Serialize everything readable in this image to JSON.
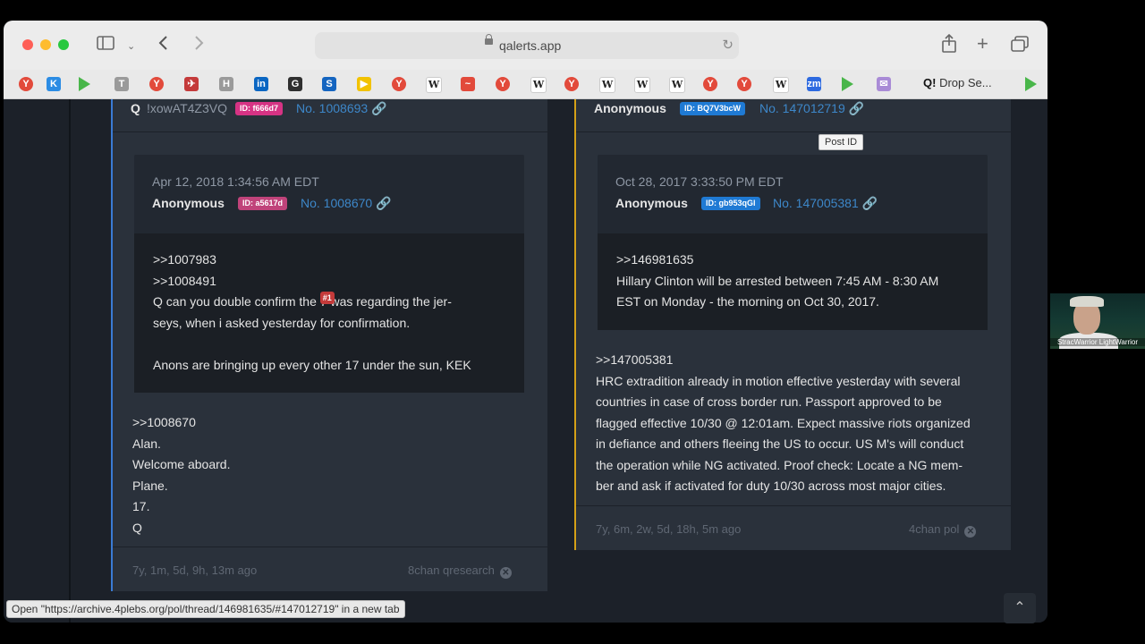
{
  "browser": {
    "url": "qalerts.app",
    "tab_title": "Drop Se...",
    "tab_q": "Q!",
    "status_link": "Open \"https://archive.4plebs.org/pol/thread/146981635/#147012719\" in a new tab",
    "tooltip": "Post ID"
  },
  "icons": {
    "back": "chevron-left-icon",
    "forward": "chevron-right-icon",
    "share": "share-icon",
    "newtab": "plus-icon",
    "tabs": "tab-overview-icon",
    "sidebar": "sidebar-icon",
    "reload": "reload-icon",
    "lock": "lock-icon"
  },
  "favorites": [
    {
      "glyph": "Y",
      "color": "#e24a3b"
    },
    {
      "glyph": "K",
      "color": "#2b8ce4"
    },
    {
      "glyph": "",
      "color": "#49b64a"
    },
    {
      "glyph": "T",
      "color": "#9a9a9a"
    },
    {
      "glyph": "Y",
      "color": "#e24a3b"
    },
    {
      "glyph": "✈",
      "color": "#c43a3a"
    },
    {
      "glyph": "H",
      "color": "#9a9a9a"
    },
    {
      "glyph": "in",
      "color": "#0a66c2"
    },
    {
      "glyph": "G",
      "color": "#2f2f2f"
    },
    {
      "glyph": "S",
      "color": "#1565c0"
    },
    {
      "glyph": "▶",
      "color": "#f2c200"
    },
    {
      "glyph": "Y",
      "color": "#e24a3b"
    },
    {
      "glyph": "W",
      "color": "#ffffff"
    },
    {
      "glyph": "~",
      "color": "#e24a3b"
    },
    {
      "glyph": "Y",
      "color": "#e24a3b"
    },
    {
      "glyph": "W",
      "color": "#ffffff"
    },
    {
      "glyph": "Y",
      "color": "#e24a3b"
    },
    {
      "glyph": "W",
      "color": "#ffffff"
    },
    {
      "glyph": "W",
      "color": "#ffffff"
    },
    {
      "glyph": "W",
      "color": "#ffffff"
    },
    {
      "glyph": "Y",
      "color": "#e24a3b"
    },
    {
      "glyph": "Y",
      "color": "#e24a3b"
    },
    {
      "glyph": "W",
      "color": "#ffffff"
    },
    {
      "glyph": "zm",
      "color": "#2d6ae0"
    },
    {
      "glyph": "",
      "color": "#49b64a"
    },
    {
      "glyph": "✉",
      "color": "#a98bd6"
    }
  ],
  "left_post": {
    "author": "Q",
    "tripcode": "!xowAT4Z3VQ",
    "id_badge": "ID: f666d7",
    "id_color": "#d63384",
    "post_no": "No. 1008693",
    "quoted": {
      "date": "Apr 12, 2018 1:34:56 AM EDT",
      "author": "Anonymous",
      "id_badge": "ID: a5617d",
      "id_color": "#c0437a",
      "post_no": "No. 1008670",
      "line1": ">>1007983",
      "line2": ">>1008491",
      "line3_pre": "Q can you double confirm the ",
      "line3_badge": "#1",
      "line3_post": "7 was regarding the jer-",
      "line4": "seys, when i asked yesterday for confirmation.",
      "line5": "Anons are bringing up every other 17 under the sun, KEK"
    },
    "body": [
      ">>1008670",
      "Alan.",
      "Welcome aboard.",
      "Plane.",
      "17.",
      "Q"
    ],
    "age": "7y, 1m, 5d, 9h, 13m ago",
    "source": "8chan qresearch"
  },
  "right_post": {
    "author": "Anonymous",
    "id_badge": "ID: BQ7V3bcW",
    "id_color": "#1f7ad4",
    "post_no": "No. 147012719",
    "quoted": {
      "date": "Oct 28, 2017 3:33:50 PM EDT",
      "author": "Anonymous",
      "id_badge": "ID: gb953qGl",
      "id_color": "#1f7ad4",
      "post_no": "No. 147005381",
      "line1": ">>146981635",
      "line2": "Hillary Clinton will be arrested between 7:45 AM - 8:30 AM",
      "line3": "EST on Monday - the morning on Oct 30, 2017."
    },
    "body": [
      ">>147005381",
      "HRC extradition already in motion effective yesterday with several",
      "countries in case of cross border run. Passport approved to be",
      "flagged effective 10/30 @ 12:01am. Expect massive riots organized",
      "in defiance and others fleeing the US to occur. US M's will conduct",
      "the operation while NG activated. Proof check: Locate a NG mem-",
      "ber and ask if activated for duty 10/30 across most major cities."
    ],
    "age": "7y, 6m, 2w, 5d, 18h, 5m ago",
    "source": "4chan pol"
  },
  "webcam_caption": "StracWarrior LightWarrior",
  "scroll_top_glyph": "⌃"
}
